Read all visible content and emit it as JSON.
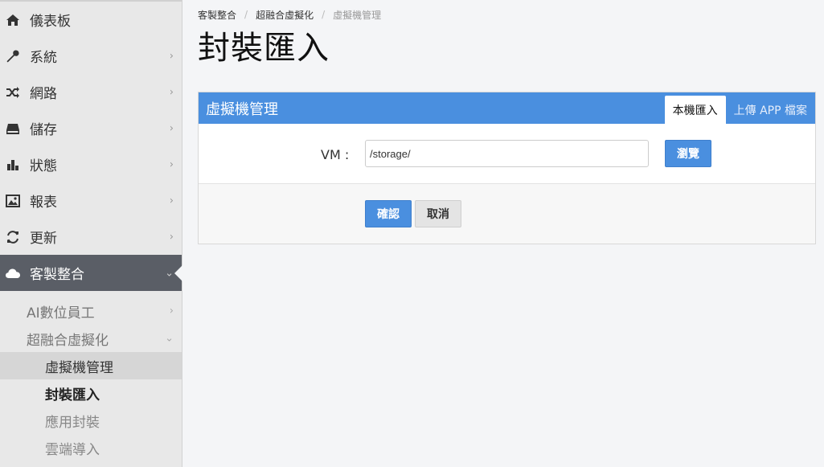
{
  "sidebar": {
    "items": [
      {
        "label": "儀表板",
        "icon": "home-icon"
      },
      {
        "label": "系統",
        "icon": "wrench-icon"
      },
      {
        "label": "網路",
        "icon": "shuffle-icon"
      },
      {
        "label": "儲存",
        "icon": "storage-icon"
      },
      {
        "label": "狀態",
        "icon": "bar-chart-icon"
      },
      {
        "label": "報表",
        "icon": "image-icon"
      },
      {
        "label": "更新",
        "icon": "refresh-icon"
      },
      {
        "label": "客製整合",
        "icon": "cloud-icon"
      }
    ],
    "sub_items": [
      {
        "label": "AI數位員工"
      },
      {
        "label": "超融合虛擬化"
      }
    ],
    "subsub_items": [
      {
        "label": "虛擬機管理"
      },
      {
        "label": "封裝匯入"
      },
      {
        "label": "應用封裝"
      },
      {
        "label": "雲端導入"
      }
    ]
  },
  "breadcrumb": [
    "客製整合",
    "超融合虛擬化",
    "虛擬機管理"
  ],
  "page_title": "封裝匯入",
  "panel": {
    "title": "虛擬機管理",
    "tabs": [
      "本機匯入",
      "上傳 APP 檔案"
    ],
    "vm_label": "VM :",
    "vm_value": "/storage/",
    "browse_label": "瀏覽",
    "confirm_label": "確認",
    "cancel_label": "取消"
  },
  "colors": {
    "accent": "#4a8fdf",
    "sidebar_active": "#5a5e66",
    "sidebar_bg": "#e8e8e8"
  }
}
